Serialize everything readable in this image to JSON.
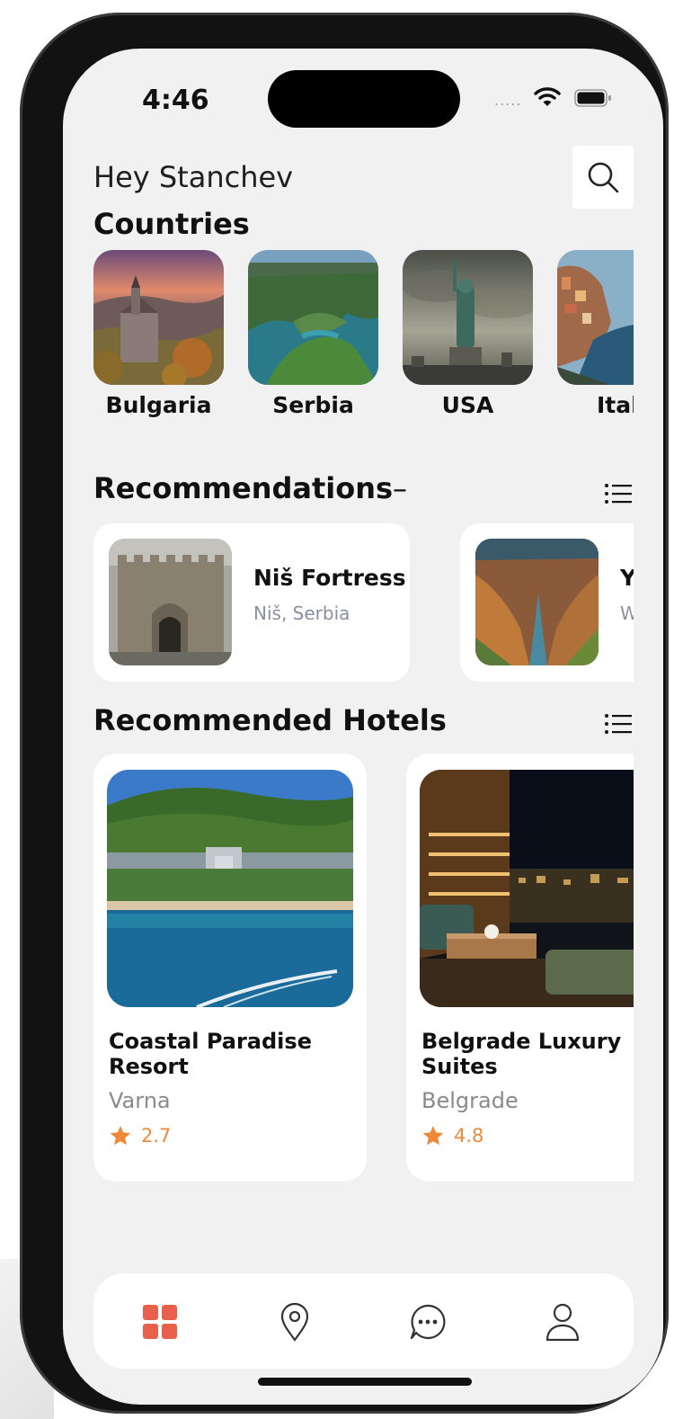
{
  "status_bar": {
    "time": "4:46",
    "signal": "....."
  },
  "header": {
    "greeting": "Hey Stanchev"
  },
  "countries": {
    "title": "Countries",
    "items": [
      {
        "label": "Bulgaria"
      },
      {
        "label": "Serbia"
      },
      {
        "label": "USA"
      },
      {
        "label": "Ital"
      }
    ]
  },
  "recommendations": {
    "title": "Recommendations",
    "dash": "–",
    "items": [
      {
        "name": "Niš Fortress",
        "location": "Niš, Serbia"
      },
      {
        "name": "Y",
        "location": "W"
      }
    ]
  },
  "hotels": {
    "title": "Recommended Hotels",
    "items": [
      {
        "name": "Coastal Paradise Resort",
        "city": "Varna",
        "rating": "2.7"
      },
      {
        "name": "Belgrade Luxury Suites",
        "city": "Belgrade",
        "rating": "4.8"
      }
    ]
  },
  "bottom_nav": {
    "items": [
      {
        "icon": "grid-icon",
        "active": true
      },
      {
        "icon": "location-pin-icon",
        "active": false
      },
      {
        "icon": "chat-bubble-icon",
        "active": false
      },
      {
        "icon": "profile-icon",
        "active": false
      }
    ]
  },
  "colors": {
    "accent": "#e8604c",
    "star": "#f0883a",
    "screen_bg": "#f1f1f1",
    "card_bg": "#ffffff",
    "muted_text": "#8a8fa0"
  }
}
